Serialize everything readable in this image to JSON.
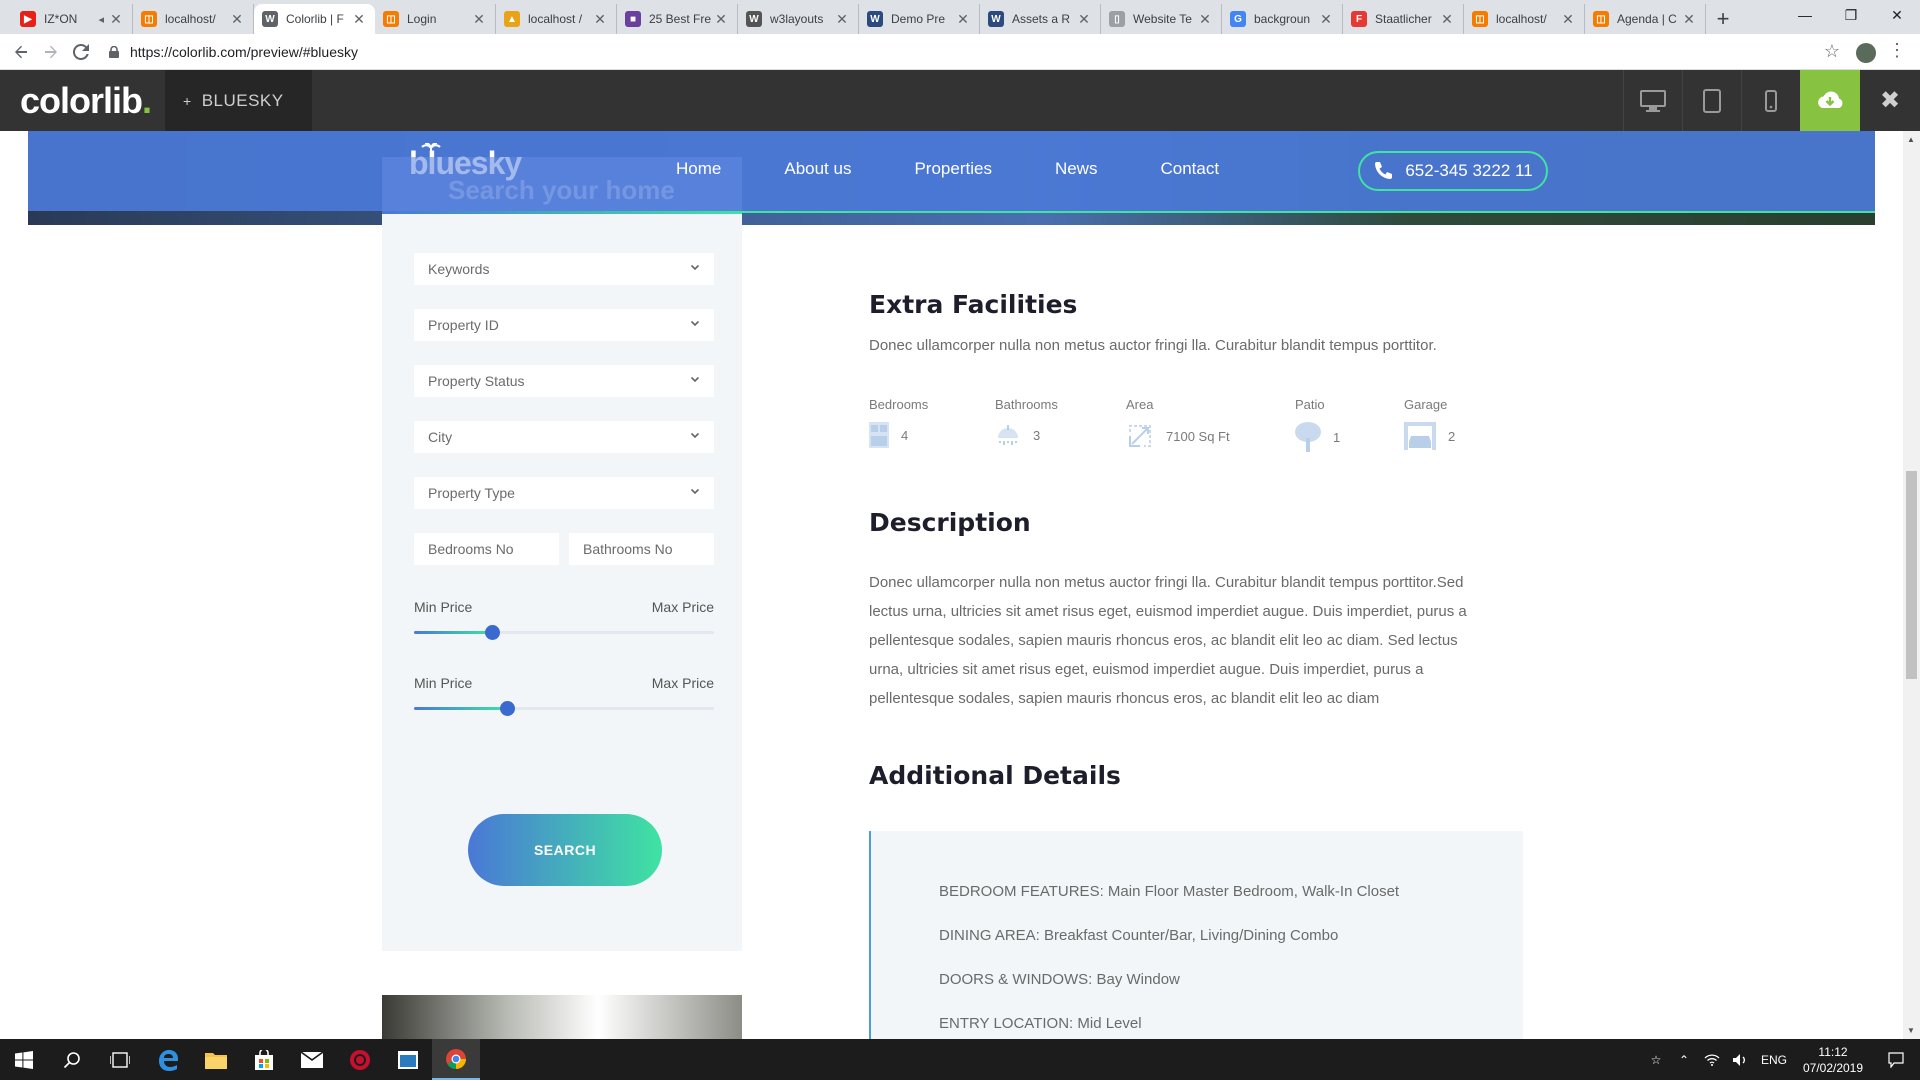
{
  "browser": {
    "tabs": [
      {
        "label": "IZ*ON",
        "favicon_color": "#e62117",
        "favicon_glyph": "▶",
        "muted": true
      },
      {
        "label": "localhost/",
        "favicon_color": "#f57c00",
        "favicon_glyph": "◫"
      },
      {
        "label": "Colorlib | F",
        "favicon_color": "#5f6368",
        "favicon_glyph": "W",
        "active": true
      },
      {
        "label": "Login",
        "favicon_color": "#f57c00",
        "favicon_glyph": "◫"
      },
      {
        "label": "localhost /",
        "favicon_color": "#e8a317",
        "favicon_glyph": "▲"
      },
      {
        "label": "25 Best Fre",
        "favicon_color": "#6a3f9e",
        "favicon_glyph": "■"
      },
      {
        "label": "w3layouts",
        "favicon_color": "#555555",
        "favicon_glyph": "W"
      },
      {
        "label": "Demo Pre",
        "favicon_color": "#2b4a7e",
        "favicon_glyph": "W"
      },
      {
        "label": "Assets a R",
        "favicon_color": "#2b4a7e",
        "favicon_glyph": "W"
      },
      {
        "label": "Website Te",
        "favicon_color": "#9aa0a6",
        "favicon_glyph": "▯"
      },
      {
        "label": "backgroun",
        "favicon_color": "#4285f4",
        "favicon_glyph": "G"
      },
      {
        "label": "Staatlicher",
        "favicon_color": "#e53935",
        "favicon_glyph": "F"
      },
      {
        "label": "localhost/",
        "favicon_color": "#f57c00",
        "favicon_glyph": "◫"
      },
      {
        "label": "Agenda | C",
        "favicon_color": "#f57c00",
        "favicon_glyph": "◫"
      }
    ],
    "new_tab_label": "+",
    "url": "https://colorlib.com/preview/#bluesky"
  },
  "colorlib_bar": {
    "logo_text": "colorlib",
    "logo_dot": ".",
    "theme_plus": "+",
    "theme_name": "BLUESKY",
    "accent_color": "#87c241"
  },
  "site": {
    "brand": "bluesky",
    "nav": [
      "Home",
      "About us",
      "Properties",
      "News",
      "Contact"
    ],
    "phone": "652-345 3222 11",
    "header_color": "#4a78d6",
    "accent_color": "#3fe3a2"
  },
  "search": {
    "title": "Search your home",
    "selects": [
      "Keywords",
      "Property ID",
      "Property Status",
      "City",
      "Property Type"
    ],
    "bedrooms_placeholder": "Bedrooms No",
    "bathrooms_placeholder": "Bathrooms No",
    "ranges": [
      {
        "min_label": "Min Price",
        "max_label": "Max Price",
        "value_fraction": 0.26
      },
      {
        "min_label": "Min Price",
        "max_label": "Max Price",
        "value_fraction": 0.31
      }
    ],
    "button_label": "SEARCH"
  },
  "extra_facilities": {
    "heading": "Extra Facilities",
    "intro": "Donec ullamcorper nulla non metus auctor fringi lla. Curabitur blandit tempus porttitor.",
    "items": [
      {
        "label": "Bedrooms",
        "value": "4",
        "icon": "bedroom-icon"
      },
      {
        "label": "Bathrooms",
        "value": "3",
        "icon": "shower-icon"
      },
      {
        "label": "Area",
        "value": "7100 Sq Ft",
        "icon": "area-icon"
      },
      {
        "label": "Patio",
        "value": "1",
        "icon": "tree-icon"
      },
      {
        "label": "Garage",
        "value": "2",
        "icon": "garage-icon"
      }
    ]
  },
  "description": {
    "heading": "Description",
    "lines": [
      "Donec ullamcorper nulla non metus auctor fringi lla. Curabitur blandit tempus porttitor.Sed",
      "lectus urna, ultricies sit amet risus eget, euismod imperdiet augue. Duis imperdiet, purus a",
      "pellentesque sodales, sapien mauris rhoncus eros, ac blandit elit leo ac diam. Sed lectus",
      "urna, ultricies sit amet risus eget, euismod imperdiet augue. Duis imperdiet, purus a",
      "pellentesque sodales, sapien mauris rhoncus eros, ac blandit elit leo ac diam"
    ]
  },
  "additional_details": {
    "heading": "Additional Details",
    "items": [
      "BEDROOM FEATURES: Main Floor Master Bedroom, Walk-In Closet",
      "DINING AREA: Breakfast Counter/Bar, Living/Dining Combo",
      "DOORS & WINDOWS: Bay Window",
      "ENTRY LOCATION: Mid Level"
    ]
  },
  "taskbar": {
    "language": "ENG",
    "time": "11:12",
    "date": "07/02/2019"
  }
}
